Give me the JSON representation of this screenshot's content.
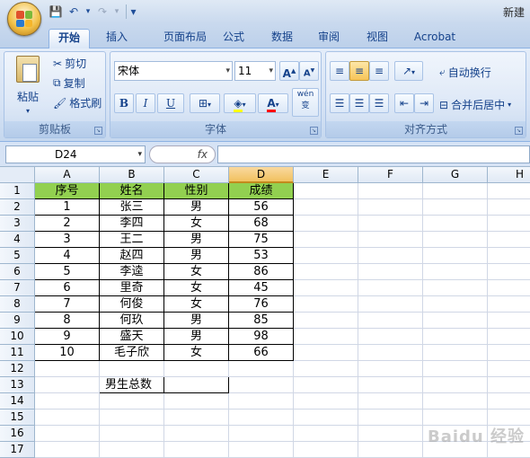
{
  "app": {
    "title": "新建"
  },
  "qat": {
    "save": "💾",
    "undo": "↶",
    "redo": "↷",
    "customize": "▾"
  },
  "tabs": [
    "开始",
    "插入",
    "页面布局",
    "公式",
    "数据",
    "审阅",
    "视图",
    "Acrobat"
  ],
  "ribbon": {
    "clipboard": {
      "label": "剪贴板",
      "paste": "粘贴",
      "cut": "剪切",
      "copy": "复制",
      "format_painter": "格式刷"
    },
    "font": {
      "label": "字体",
      "font_name": "宋体",
      "font_size": "11",
      "grow": "A",
      "shrink": "A",
      "bold": "B",
      "italic": "I",
      "underline": "U",
      "phonetic": "wén 变"
    },
    "alignment": {
      "label": "对齐方式",
      "wrap_text": "自动换行",
      "merge_center": "合并后居中"
    }
  },
  "formula_bar": {
    "name_box": "D24",
    "fx": "fx",
    "formula": ""
  },
  "sheet": {
    "columns": [
      "A",
      "B",
      "C",
      "D",
      "E",
      "F",
      "G",
      "H"
    ],
    "selected_column": "D",
    "rows": [
      "1",
      "2",
      "3",
      "4",
      "5",
      "6",
      "7",
      "8",
      "9",
      "10",
      "11",
      "12",
      "13",
      "14",
      "15",
      "16",
      "17"
    ],
    "headers": [
      "序号",
      "姓名",
      "性别",
      "成绩"
    ],
    "data": [
      [
        "1",
        "张三",
        "男",
        "56"
      ],
      [
        "2",
        "李四",
        "女",
        "68"
      ],
      [
        "3",
        "王二",
        "男",
        "75"
      ],
      [
        "4",
        "赵四",
        "男",
        "53"
      ],
      [
        "5",
        "李逵",
        "女",
        "86"
      ],
      [
        "6",
        "里奇",
        "女",
        "45"
      ],
      [
        "7",
        "何俊",
        "女",
        "76"
      ],
      [
        "8",
        "何玖",
        "男",
        "85"
      ],
      [
        "9",
        "盛天",
        "男",
        "98"
      ],
      [
        "10",
        "毛子欣",
        "女",
        "66"
      ]
    ],
    "summary_label": "男生总数",
    "summary_value": ""
  },
  "colors": {
    "header_fill": "#92d050",
    "selected_col": "#f1c15f"
  },
  "watermark": "Baidu 经验"
}
